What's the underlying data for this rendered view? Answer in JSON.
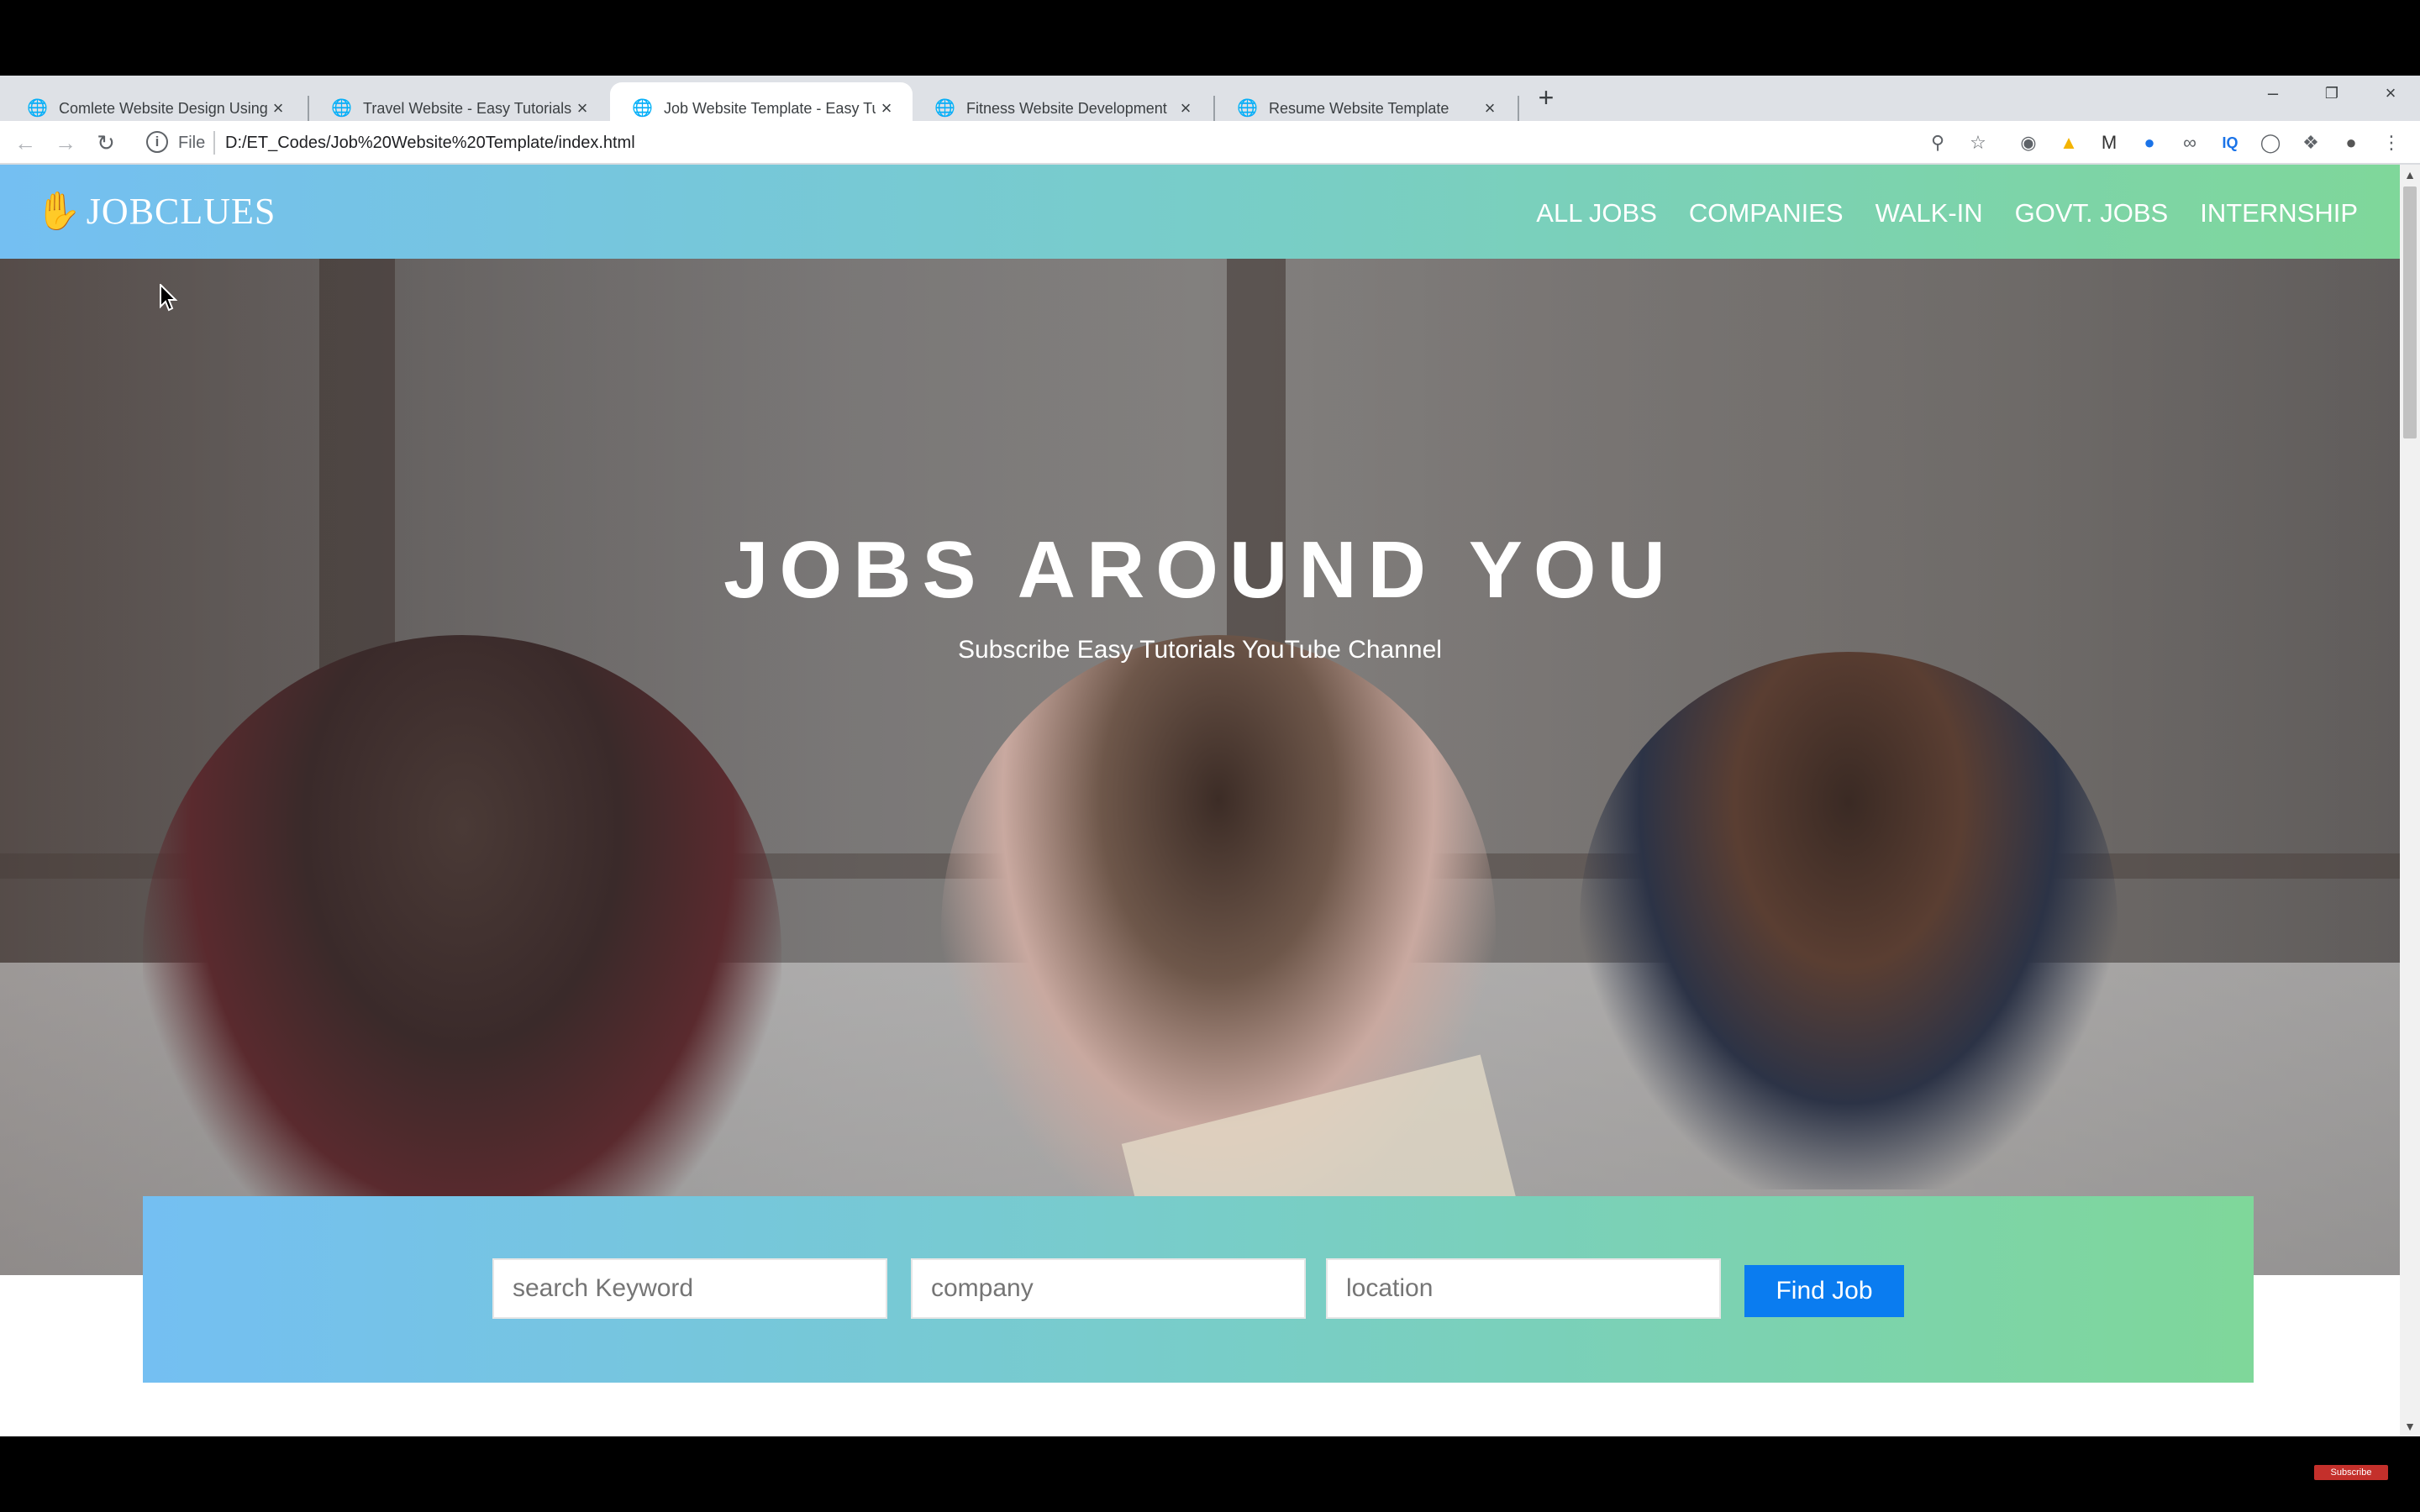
{
  "browser": {
    "tabs": [
      {
        "label": "Comlete Website Design Using H",
        "active": false
      },
      {
        "label": "Travel Website - Easy Tutorials",
        "active": false
      },
      {
        "label": "Job Website Template - Easy Tut",
        "active": true
      },
      {
        "label": "Fitness Website Development",
        "active": false
      },
      {
        "label": "Resume Website Template",
        "active": false
      }
    ],
    "address": {
      "scheme_label": "File",
      "url": "D:/ET_Codes/Job%20Website%20Template/index.html"
    }
  },
  "site": {
    "logo_text": "JOBCLUES",
    "nav": [
      "ALL JOBS",
      "COMPANIES",
      "WALK-IN",
      "GOVT. JOBS",
      "INTERNSHIP"
    ],
    "hero": {
      "title": "JOBS AROUND YOU",
      "subtitle": "Subscribe Easy Tutorials YouTube Channel"
    },
    "search": {
      "keyword_placeholder": "search Keyword",
      "company_placeholder": "company",
      "location_placeholder": "location",
      "button_label": "Find Job"
    }
  },
  "overlay": {
    "subscribe_label": "Subscribe"
  },
  "colors": {
    "gradient_start": "#74bff2",
    "gradient_end": "#7fd79a",
    "button_blue": "#0a7cf0"
  }
}
